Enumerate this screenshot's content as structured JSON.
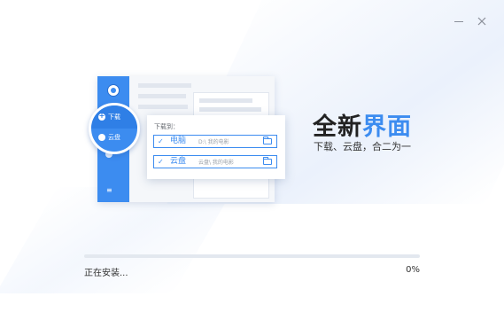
{
  "window": {
    "minimize_glyph": "—",
    "close_glyph": "✕"
  },
  "illustration": {
    "bubble_download_label": "下载",
    "bubble_cloud_label": "云盘",
    "sidebar_small_label": "",
    "dialog": {
      "title": "下载到：",
      "options": [
        {
          "label": "电脑",
          "path": "D:\\ 我的电影",
          "checked": true
        },
        {
          "label": "云盘",
          "path": "云盘\\ 我的电影",
          "checked": true
        }
      ]
    }
  },
  "headline": {
    "part1": "全新",
    "part2": "界面",
    "subtitle": "下载、云盘，合二为一"
  },
  "progress": {
    "status": "正在安装...",
    "percent_label": "0%",
    "value": 0.0
  },
  "colors": {
    "accent": "#3c8cf0",
    "text": "#333333",
    "track": "#e3e8ef"
  }
}
